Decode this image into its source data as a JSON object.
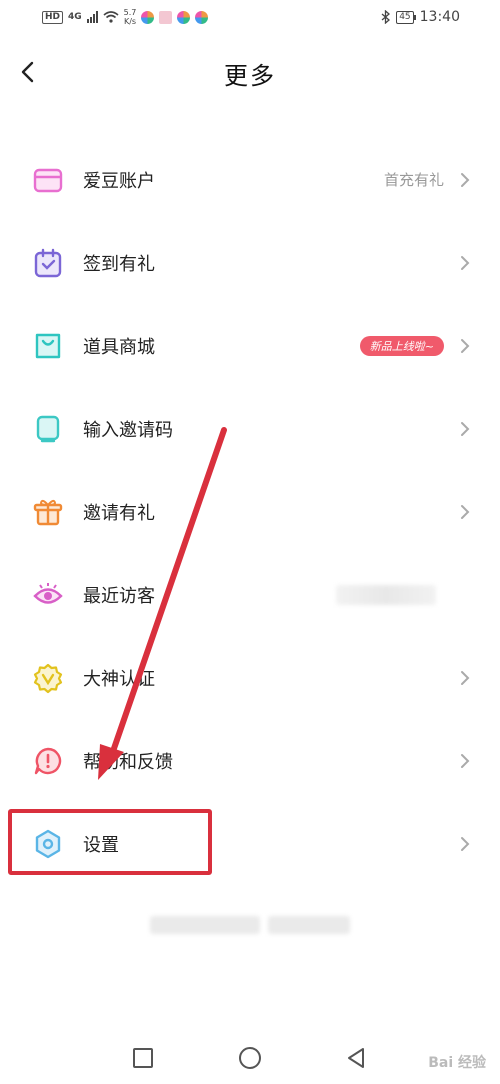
{
  "status_bar": {
    "hd": "HD",
    "network": "4G",
    "speed_value": "5.7",
    "speed_unit": "K/s",
    "battery": "45",
    "time": "13:40"
  },
  "header": {
    "title": "更多"
  },
  "menu": [
    {
      "label": "爱豆账户",
      "sub": "首充有礼",
      "icon": "wallet-icon",
      "color": "#e86fd0"
    },
    {
      "label": "签到有礼",
      "icon": "sign-in-calendar-icon",
      "color": "#7b66d6"
    },
    {
      "label": "道具商城",
      "badge": "新品上线啦~",
      "icon": "shopping-bag-icon",
      "color": "#2ec5c0"
    },
    {
      "label": "输入邀请码",
      "icon": "invite-code-icon",
      "color": "#3cc8c4"
    },
    {
      "label": "邀请有礼",
      "icon": "gift-icon",
      "color": "#f08a35"
    },
    {
      "label": "最近访客",
      "icon": "eye-icon",
      "color": "#d85fc7"
    },
    {
      "label": "大神认证",
      "icon": "verified-badge-icon",
      "color": "#e2c21e"
    },
    {
      "label": "帮助和反馈",
      "icon": "help-feedback-icon",
      "color": "#ef5466"
    },
    {
      "label": "设置",
      "icon": "settings-hexagon-icon",
      "color": "#5ab5e6"
    }
  ],
  "watermark": "Bai 经验",
  "colors": {
    "annotation": "#d9303d",
    "badge": "#f05a6b"
  }
}
